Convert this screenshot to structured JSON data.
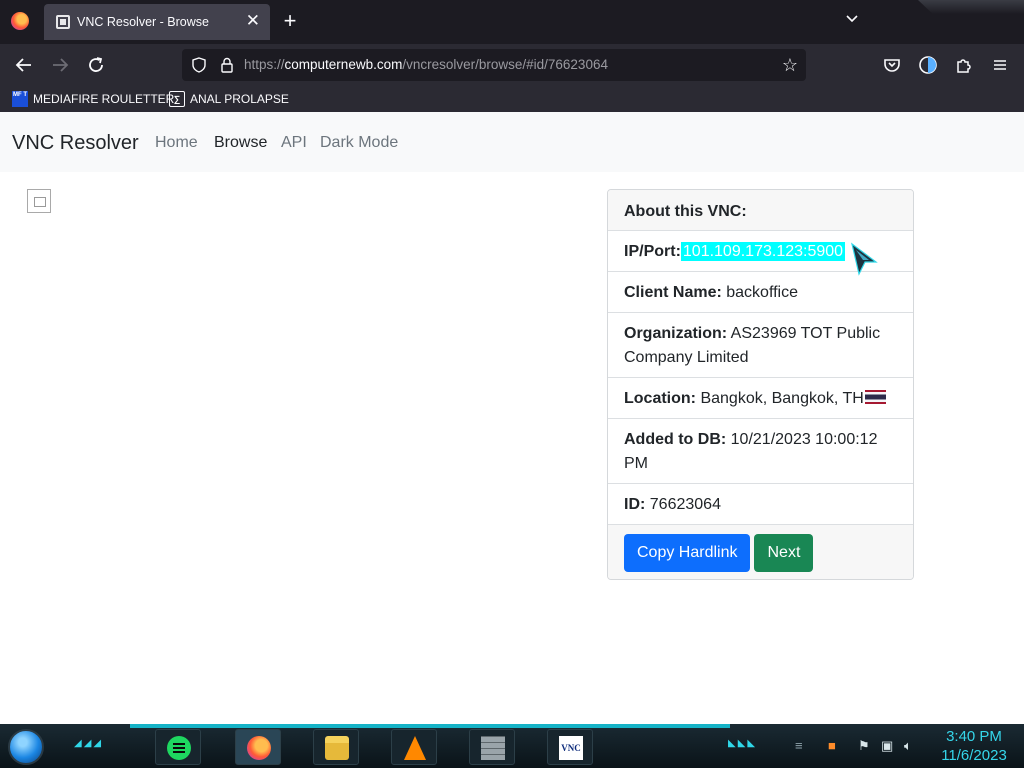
{
  "browser": {
    "tab_title": "VNC Resolver - Browse",
    "url_prefix": "https://",
    "url_host": "computernewb.com",
    "url_path": "/vncresolver/browse/#id/76623064",
    "bookmarks": [
      {
        "label": "MEDIAFIRE ROULETTER",
        "icon": "mediafire-icon",
        "icon_text": "MF T"
      },
      {
        "label": "ANAL PROLAPSE",
        "icon": "terminal-icon",
        "icon_text": "∑"
      }
    ]
  },
  "site": {
    "brand": "VNC Resolver",
    "nav": [
      "Home",
      "Browse",
      "API",
      "Dark Mode"
    ],
    "active_nav": "Browse"
  },
  "card": {
    "header": "About this VNC:",
    "ip_label": "IP/Port:",
    "ip_value": "101.109.173.123:5900",
    "client_label": "Client Name:",
    "client_value": "backoffice",
    "org_label": "Organization:",
    "org_value": "AS23969 TOT Public Company Limited",
    "loc_label": "Location:",
    "loc_value": "Bangkok, Bangkok, TH",
    "added_label": "Added to DB:",
    "added_value": "10/21/2023 10:00:12 PM",
    "id_label": "ID:",
    "id_value": "76623064",
    "copy_button": "Copy Hardlink",
    "next_button": "Next"
  },
  "taskbar": {
    "apps": [
      "spotify-icon",
      "firefox-icon",
      "file-explorer-icon",
      "vlc-icon",
      "firewall-icon",
      "vnc-viewer-icon"
    ],
    "vnc_icon_text": "VNC",
    "time": "3:40 PM",
    "date": "11/6/2023"
  },
  "colors": {
    "primary": "#0d6efd",
    "success": "#198754",
    "highlight": "#00ffff",
    "browser_dark": "#2b2a33"
  }
}
